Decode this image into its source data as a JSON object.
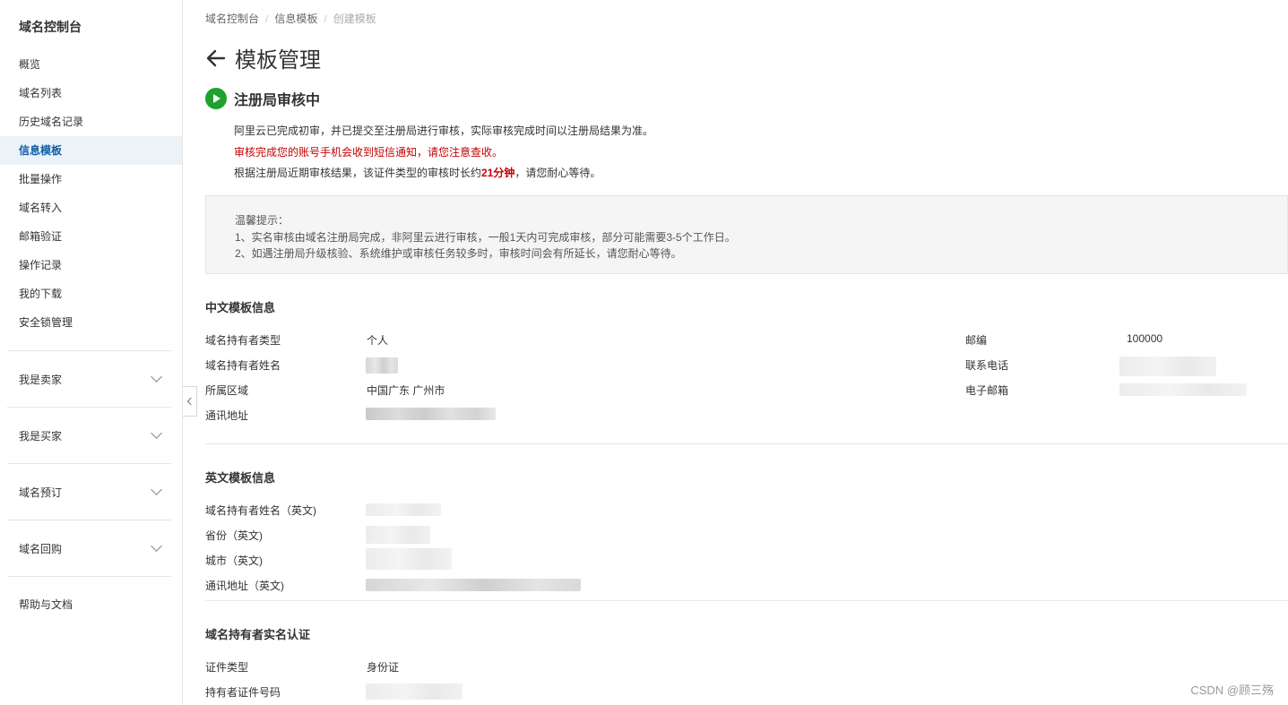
{
  "sidebar": {
    "title": "域名控制台",
    "items": [
      {
        "label": "概览"
      },
      {
        "label": "域名列表"
      },
      {
        "label": "历史域名记录"
      },
      {
        "label": "信息模板"
      },
      {
        "label": "批量操作"
      },
      {
        "label": "域名转入"
      },
      {
        "label": "邮箱验证"
      },
      {
        "label": "操作记录"
      },
      {
        "label": "我的下载"
      },
      {
        "label": "安全锁管理"
      }
    ],
    "active_index": 3,
    "groups": [
      {
        "label": "我是卖家"
      },
      {
        "label": "我是买家"
      },
      {
        "label": "域名预订"
      },
      {
        "label": "域名回购"
      }
    ],
    "help": "帮助与文档"
  },
  "breadcrumb": {
    "items": [
      "域名控制台",
      "信息模板",
      "创建模板"
    ]
  },
  "page": {
    "title": "模板管理"
  },
  "status": {
    "title": "注册局审核中",
    "line1": "阿里云已完成初审，并已提交至注册局进行审核，实际审核完成时间以注册局结果为准。",
    "line2": "审核完成您的账号手机会收到短信通知，请您注意查收。",
    "line3_prefix": "根据注册局近期审核结果，该证件类型的审核时长约",
    "line3_highlight": "21分钟",
    "line3_suffix": "，请您耐心等待。"
  },
  "tips": {
    "title": "温馨提示：",
    "line1": "1、实名审核由域名注册局完成，非阿里云进行审核，一般1天内可完成审核，部分可能需要3-5个工作日。",
    "line2": "2、如遇注册局升级核验、系统维护或审核任务较多时，审核时间会有所延长，请您耐心等待。"
  },
  "cn_info": {
    "title": "中文模板信息",
    "holder_type_label": "域名持有者类型",
    "holder_type_value": "个人",
    "holder_name_label": "域名持有者姓名",
    "region_label": "所属区域",
    "region_value": "中国广东 广州市",
    "address_label": "通讯地址",
    "postcode_label": "邮编",
    "postcode_value": "100000",
    "phone_label": "联系电话",
    "email_label": "电子邮箱"
  },
  "en_info": {
    "title": "英文模板信息",
    "holder_name_label": "域名持有者姓名（英文)",
    "province_label": "省份（英文)",
    "city_label": "城市（英文)",
    "address_label": "通讯地址（英文)"
  },
  "verify": {
    "title": "域名持有者实名认证",
    "id_type_label": "证件类型",
    "id_type_value": "身份证",
    "id_no_label": "持有者证件号码"
  },
  "watermark": "CSDN @顾三殇"
}
